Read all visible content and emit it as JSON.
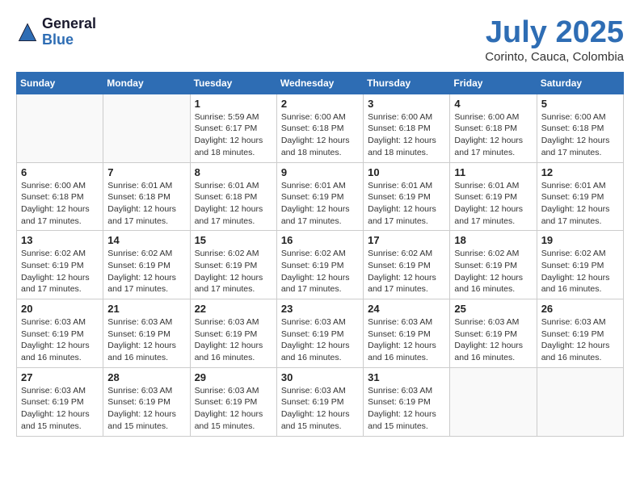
{
  "header": {
    "logo_general": "General",
    "logo_blue": "Blue",
    "month_title": "July 2025",
    "location": "Corinto, Cauca, Colombia"
  },
  "calendar": {
    "days_of_week": [
      "Sunday",
      "Monday",
      "Tuesday",
      "Wednesday",
      "Thursday",
      "Friday",
      "Saturday"
    ],
    "weeks": [
      [
        {
          "day": "",
          "info": ""
        },
        {
          "day": "",
          "info": ""
        },
        {
          "day": "1",
          "info": "Sunrise: 5:59 AM\nSunset: 6:17 PM\nDaylight: 12 hours and 18 minutes."
        },
        {
          "day": "2",
          "info": "Sunrise: 6:00 AM\nSunset: 6:18 PM\nDaylight: 12 hours and 18 minutes."
        },
        {
          "day": "3",
          "info": "Sunrise: 6:00 AM\nSunset: 6:18 PM\nDaylight: 12 hours and 18 minutes."
        },
        {
          "day": "4",
          "info": "Sunrise: 6:00 AM\nSunset: 6:18 PM\nDaylight: 12 hours and 17 minutes."
        },
        {
          "day": "5",
          "info": "Sunrise: 6:00 AM\nSunset: 6:18 PM\nDaylight: 12 hours and 17 minutes."
        }
      ],
      [
        {
          "day": "6",
          "info": "Sunrise: 6:00 AM\nSunset: 6:18 PM\nDaylight: 12 hours and 17 minutes."
        },
        {
          "day": "7",
          "info": "Sunrise: 6:01 AM\nSunset: 6:18 PM\nDaylight: 12 hours and 17 minutes."
        },
        {
          "day": "8",
          "info": "Sunrise: 6:01 AM\nSunset: 6:18 PM\nDaylight: 12 hours and 17 minutes."
        },
        {
          "day": "9",
          "info": "Sunrise: 6:01 AM\nSunset: 6:19 PM\nDaylight: 12 hours and 17 minutes."
        },
        {
          "day": "10",
          "info": "Sunrise: 6:01 AM\nSunset: 6:19 PM\nDaylight: 12 hours and 17 minutes."
        },
        {
          "day": "11",
          "info": "Sunrise: 6:01 AM\nSunset: 6:19 PM\nDaylight: 12 hours and 17 minutes."
        },
        {
          "day": "12",
          "info": "Sunrise: 6:01 AM\nSunset: 6:19 PM\nDaylight: 12 hours and 17 minutes."
        }
      ],
      [
        {
          "day": "13",
          "info": "Sunrise: 6:02 AM\nSunset: 6:19 PM\nDaylight: 12 hours and 17 minutes."
        },
        {
          "day": "14",
          "info": "Sunrise: 6:02 AM\nSunset: 6:19 PM\nDaylight: 12 hours and 17 minutes."
        },
        {
          "day": "15",
          "info": "Sunrise: 6:02 AM\nSunset: 6:19 PM\nDaylight: 12 hours and 17 minutes."
        },
        {
          "day": "16",
          "info": "Sunrise: 6:02 AM\nSunset: 6:19 PM\nDaylight: 12 hours and 17 minutes."
        },
        {
          "day": "17",
          "info": "Sunrise: 6:02 AM\nSunset: 6:19 PM\nDaylight: 12 hours and 17 minutes."
        },
        {
          "day": "18",
          "info": "Sunrise: 6:02 AM\nSunset: 6:19 PM\nDaylight: 12 hours and 16 minutes."
        },
        {
          "day": "19",
          "info": "Sunrise: 6:02 AM\nSunset: 6:19 PM\nDaylight: 12 hours and 16 minutes."
        }
      ],
      [
        {
          "day": "20",
          "info": "Sunrise: 6:03 AM\nSunset: 6:19 PM\nDaylight: 12 hours and 16 minutes."
        },
        {
          "day": "21",
          "info": "Sunrise: 6:03 AM\nSunset: 6:19 PM\nDaylight: 12 hours and 16 minutes."
        },
        {
          "day": "22",
          "info": "Sunrise: 6:03 AM\nSunset: 6:19 PM\nDaylight: 12 hours and 16 minutes."
        },
        {
          "day": "23",
          "info": "Sunrise: 6:03 AM\nSunset: 6:19 PM\nDaylight: 12 hours and 16 minutes."
        },
        {
          "day": "24",
          "info": "Sunrise: 6:03 AM\nSunset: 6:19 PM\nDaylight: 12 hours and 16 minutes."
        },
        {
          "day": "25",
          "info": "Sunrise: 6:03 AM\nSunset: 6:19 PM\nDaylight: 12 hours and 16 minutes."
        },
        {
          "day": "26",
          "info": "Sunrise: 6:03 AM\nSunset: 6:19 PM\nDaylight: 12 hours and 16 minutes."
        }
      ],
      [
        {
          "day": "27",
          "info": "Sunrise: 6:03 AM\nSunset: 6:19 PM\nDaylight: 12 hours and 15 minutes."
        },
        {
          "day": "28",
          "info": "Sunrise: 6:03 AM\nSunset: 6:19 PM\nDaylight: 12 hours and 15 minutes."
        },
        {
          "day": "29",
          "info": "Sunrise: 6:03 AM\nSunset: 6:19 PM\nDaylight: 12 hours and 15 minutes."
        },
        {
          "day": "30",
          "info": "Sunrise: 6:03 AM\nSunset: 6:19 PM\nDaylight: 12 hours and 15 minutes."
        },
        {
          "day": "31",
          "info": "Sunrise: 6:03 AM\nSunset: 6:19 PM\nDaylight: 12 hours and 15 minutes."
        },
        {
          "day": "",
          "info": ""
        },
        {
          "day": "",
          "info": ""
        }
      ]
    ]
  }
}
